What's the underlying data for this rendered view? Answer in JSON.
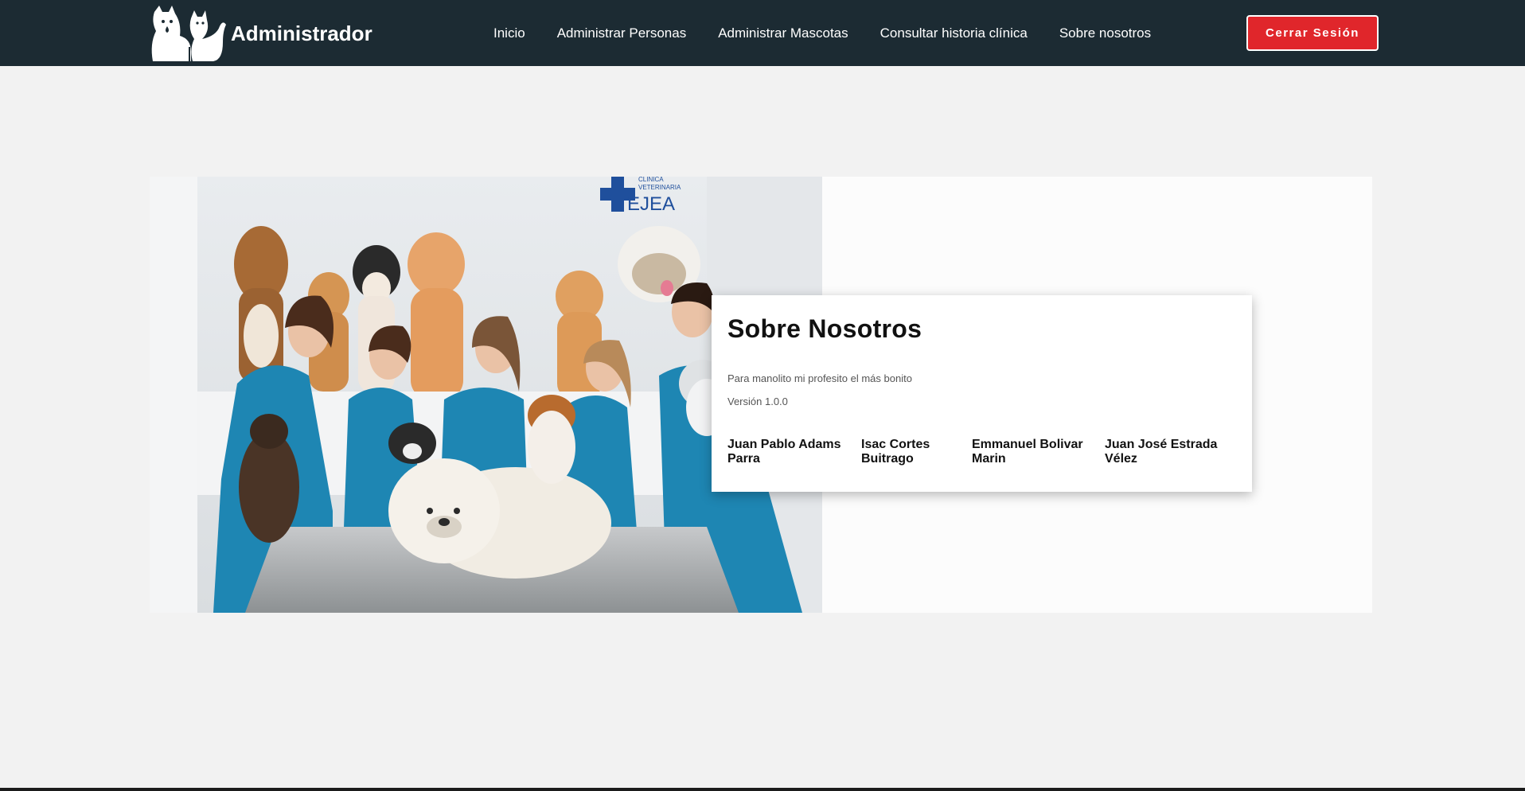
{
  "header": {
    "brand_title": "Administrador",
    "brand_icon": "cat-dog-logo-icon",
    "nav": [
      {
        "label": "Inicio"
      },
      {
        "label": "Administrar Personas"
      },
      {
        "label": "Administrar Mascotas"
      },
      {
        "label": "Consultar historia clínica"
      },
      {
        "label": "Sobre nosotros"
      }
    ],
    "logout_label": "Cerrar Sesión",
    "colors": {
      "navbar": "#1c2b33",
      "logout": "#e0262b"
    }
  },
  "hero": {
    "image": "veterinary-team-with-pets-photo",
    "sign_text": {
      "line1": "CLÍNICA",
      "line2": "VETERINARIA",
      "brand": "EJEA"
    }
  },
  "about": {
    "title": "Sobre Nosotros",
    "description": "Para manolito mi profesito el más bonito",
    "version": "Versión 1.0.0",
    "authors": [
      {
        "line1": "Juan Pablo Adams",
        "line2": "Parra"
      },
      {
        "line1": "Isac Cortes",
        "line2": "Buitrago"
      },
      {
        "line1": "Emmanuel Bolivar",
        "line2": "Marin"
      },
      {
        "line1": "Juan José Estrada",
        "line2": "Vélez"
      }
    ]
  }
}
